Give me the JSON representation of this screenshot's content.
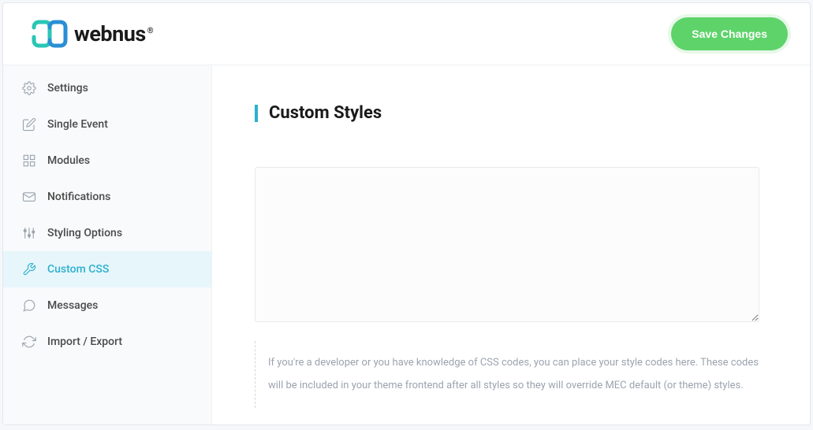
{
  "header": {
    "logo_text": "webnus",
    "save_label": "Save Changes"
  },
  "sidebar": {
    "items": [
      {
        "label": "Settings",
        "icon": "gear-icon",
        "active": false
      },
      {
        "label": "Single Event",
        "icon": "edit-icon",
        "active": false
      },
      {
        "label": "Modules",
        "icon": "grid-icon",
        "active": false
      },
      {
        "label": "Notifications",
        "icon": "mail-icon",
        "active": false
      },
      {
        "label": "Styling Options",
        "icon": "sliders-icon",
        "active": false
      },
      {
        "label": "Custom CSS",
        "icon": "wrench-icon",
        "active": true
      },
      {
        "label": "Messages",
        "icon": "chat-icon",
        "active": false
      },
      {
        "label": "Import / Export",
        "icon": "refresh-icon",
        "active": false
      }
    ]
  },
  "main": {
    "title": "Custom Styles",
    "textarea_value": "",
    "help_text": "If you're a developer or you have knowledge of CSS codes, you can place your style codes here. These codes will be included in your theme frontend after all styles so they will override MEC default (or theme) styles."
  }
}
